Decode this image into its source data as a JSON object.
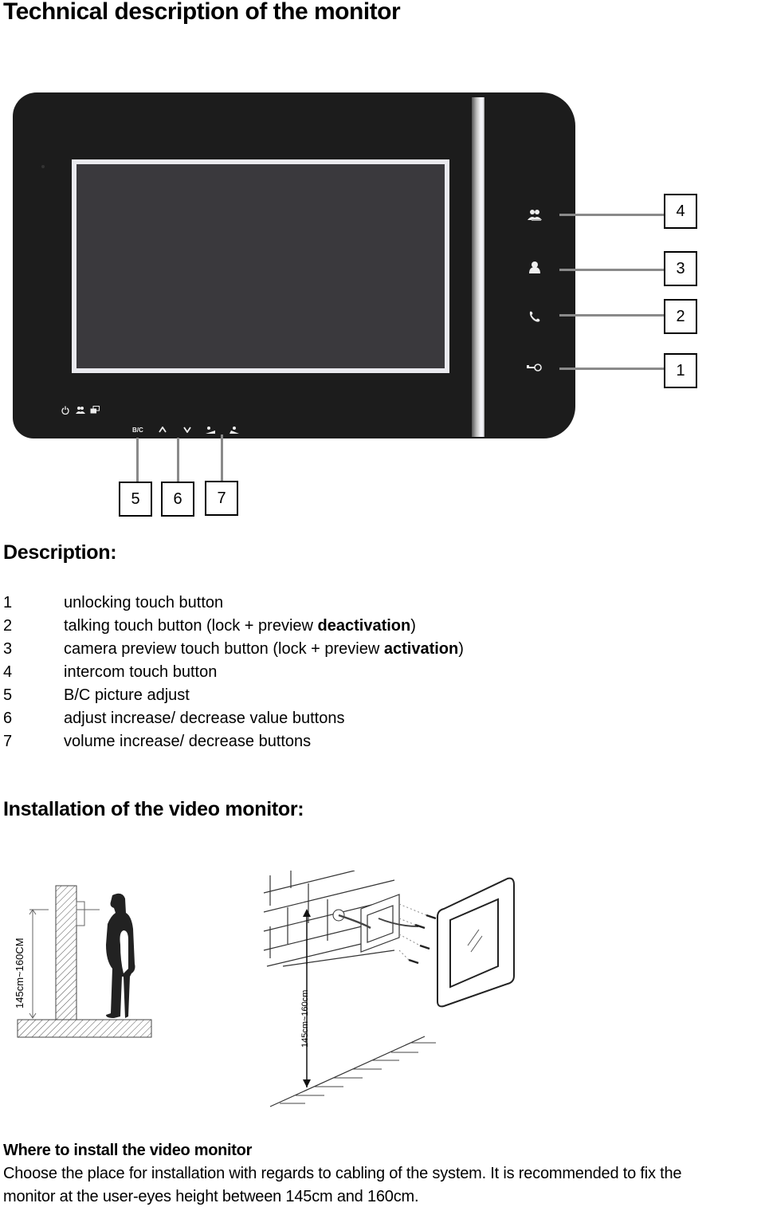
{
  "page": {
    "title": "Technical description of the monitor"
  },
  "monitor_figure": {
    "side_buttons": [
      {
        "callout": "4",
        "icon": "intercom-group-icon"
      },
      {
        "callout": "3",
        "icon": "camera-preview-person-icon"
      },
      {
        "callout": "2",
        "icon": "handset-phone-icon"
      },
      {
        "callout": "1",
        "icon": "key-unlock-icon"
      }
    ],
    "status_icons": [
      "power-icon",
      "group-icon",
      "windows-icon"
    ],
    "bottom_buttons": [
      {
        "label": "B/C",
        "icon": "bc-text"
      },
      {
        "label": "∧",
        "icon": "chevron-up-icon"
      },
      {
        "label": "∨",
        "icon": "chevron-down-icon"
      },
      {
        "label": "",
        "icon": "volume-up-icon"
      },
      {
        "label": "",
        "icon": "volume-down-icon"
      }
    ],
    "bottom_callouts": [
      "5",
      "6",
      "7"
    ]
  },
  "description": {
    "heading": "Description:",
    "items": [
      {
        "num": "1",
        "text": "unlocking touch button",
        "bold": "",
        "after": ""
      },
      {
        "num": "2",
        "text": "talking touch button (lock + preview ",
        "bold": "deactivation",
        "after": ")"
      },
      {
        "num": "3",
        "text": "camera preview touch button (lock + preview ",
        "bold": "activation",
        "after": ")"
      },
      {
        "num": "4",
        "text": "intercom touch button",
        "bold": "",
        "after": ""
      },
      {
        "num": "5",
        "text": "B/C picture adjust",
        "bold": "",
        "after": ""
      },
      {
        "num": "6",
        "text": "adjust increase/ decrease value buttons",
        "bold": "",
        "after": ""
      },
      {
        "num": "7",
        "text": "volume increase/ decrease buttons",
        "bold": "",
        "after": ""
      }
    ]
  },
  "installation": {
    "heading": "Installation of the video monitor:",
    "figure_left_label": "145cm~160CM",
    "figure_right_label": "145cm~160cm"
  },
  "where_to_install": {
    "title": "Where to install the video monitor",
    "line1": "Choose the place for installation with regards to cabling of the system. It is recommended to fix the",
    "line2": "monitor at the user-eyes height between 145cm and 160cm."
  }
}
